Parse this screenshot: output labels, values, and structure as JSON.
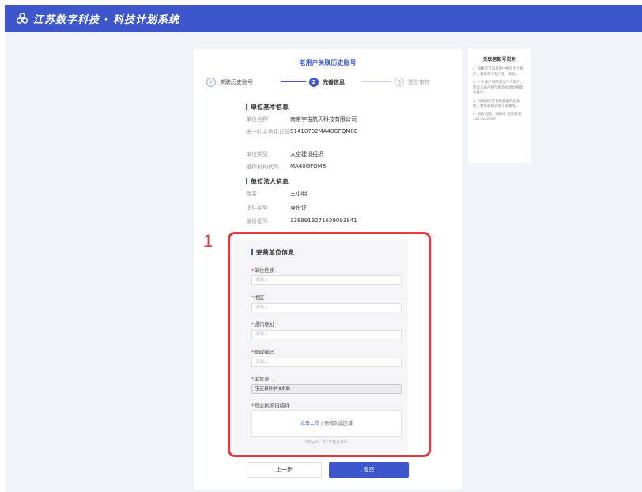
{
  "header": {
    "title": "江苏数字科技 · 科技计划系统"
  },
  "card": {
    "title": "老用户关联历史账号"
  },
  "steps": [
    {
      "num": "✓",
      "label": "关联历史账号"
    },
    {
      "num": "2",
      "label": "完善信息"
    },
    {
      "num": "3",
      "label": "提交审核"
    }
  ],
  "basic": {
    "title": "单位基本信息",
    "rows": [
      {
        "label": "单位名称",
        "value": "南京宇宙航天科技有限公司"
      },
      {
        "label": "统一社会信用代码",
        "value": "91410702MA40GFQM8E"
      },
      {
        "label": "单位类型",
        "value": "太空建设组织"
      },
      {
        "label": "组织机构代码",
        "value": "MA40GFQM8"
      }
    ]
  },
  "legal": {
    "title": "单位法人信息",
    "rows": [
      {
        "label": "姓名",
        "value": "王小明"
      },
      {
        "label": "证件类型",
        "value": "身份证"
      },
      {
        "label": "身份证号",
        "value": "338991827162909384​1"
      }
    ]
  },
  "form": {
    "title": "完善单位信息",
    "nature_label": "单位性质",
    "nature_placeholder": "请输入",
    "region_label": "地区",
    "region_placeholder": "请输入",
    "address_label": "通讯地址",
    "address_placeholder": "请输入",
    "postcode_label": "邮政编码",
    "postcode_placeholder": "请输入",
    "dept_label": "主管部门",
    "dept_value": "宝应县科学技术局",
    "license_label": "营业执照扫描件",
    "upload_link": "点击上传",
    "upload_sep": "/",
    "upload_drag": "拖拽到此区域",
    "upload_hint": "支持pdf，单个不超过5MB"
  },
  "annotation": {
    "marker": "1"
  },
  "buttons": {
    "prev": "上一步",
    "submit": "提交"
  },
  "side": {
    "title": "关联老账号说明",
    "items": [
      "1. 如果您在旧系统中拥有多个账户，请将每个账户逐一添加。",
      "2. 个人账户仅能添加个人账户，而法人账户则仅限添加单位管理员账户。",
      "3. 为确保历史系统数据的准确性，请务必如实填写旧账号。",
      "4. 如有问题，请致电 咨询电话: 12345678​90"
    ]
  },
  "colors": {
    "primary": "#3d56c9",
    "highlight": "#e13b3b"
  }
}
